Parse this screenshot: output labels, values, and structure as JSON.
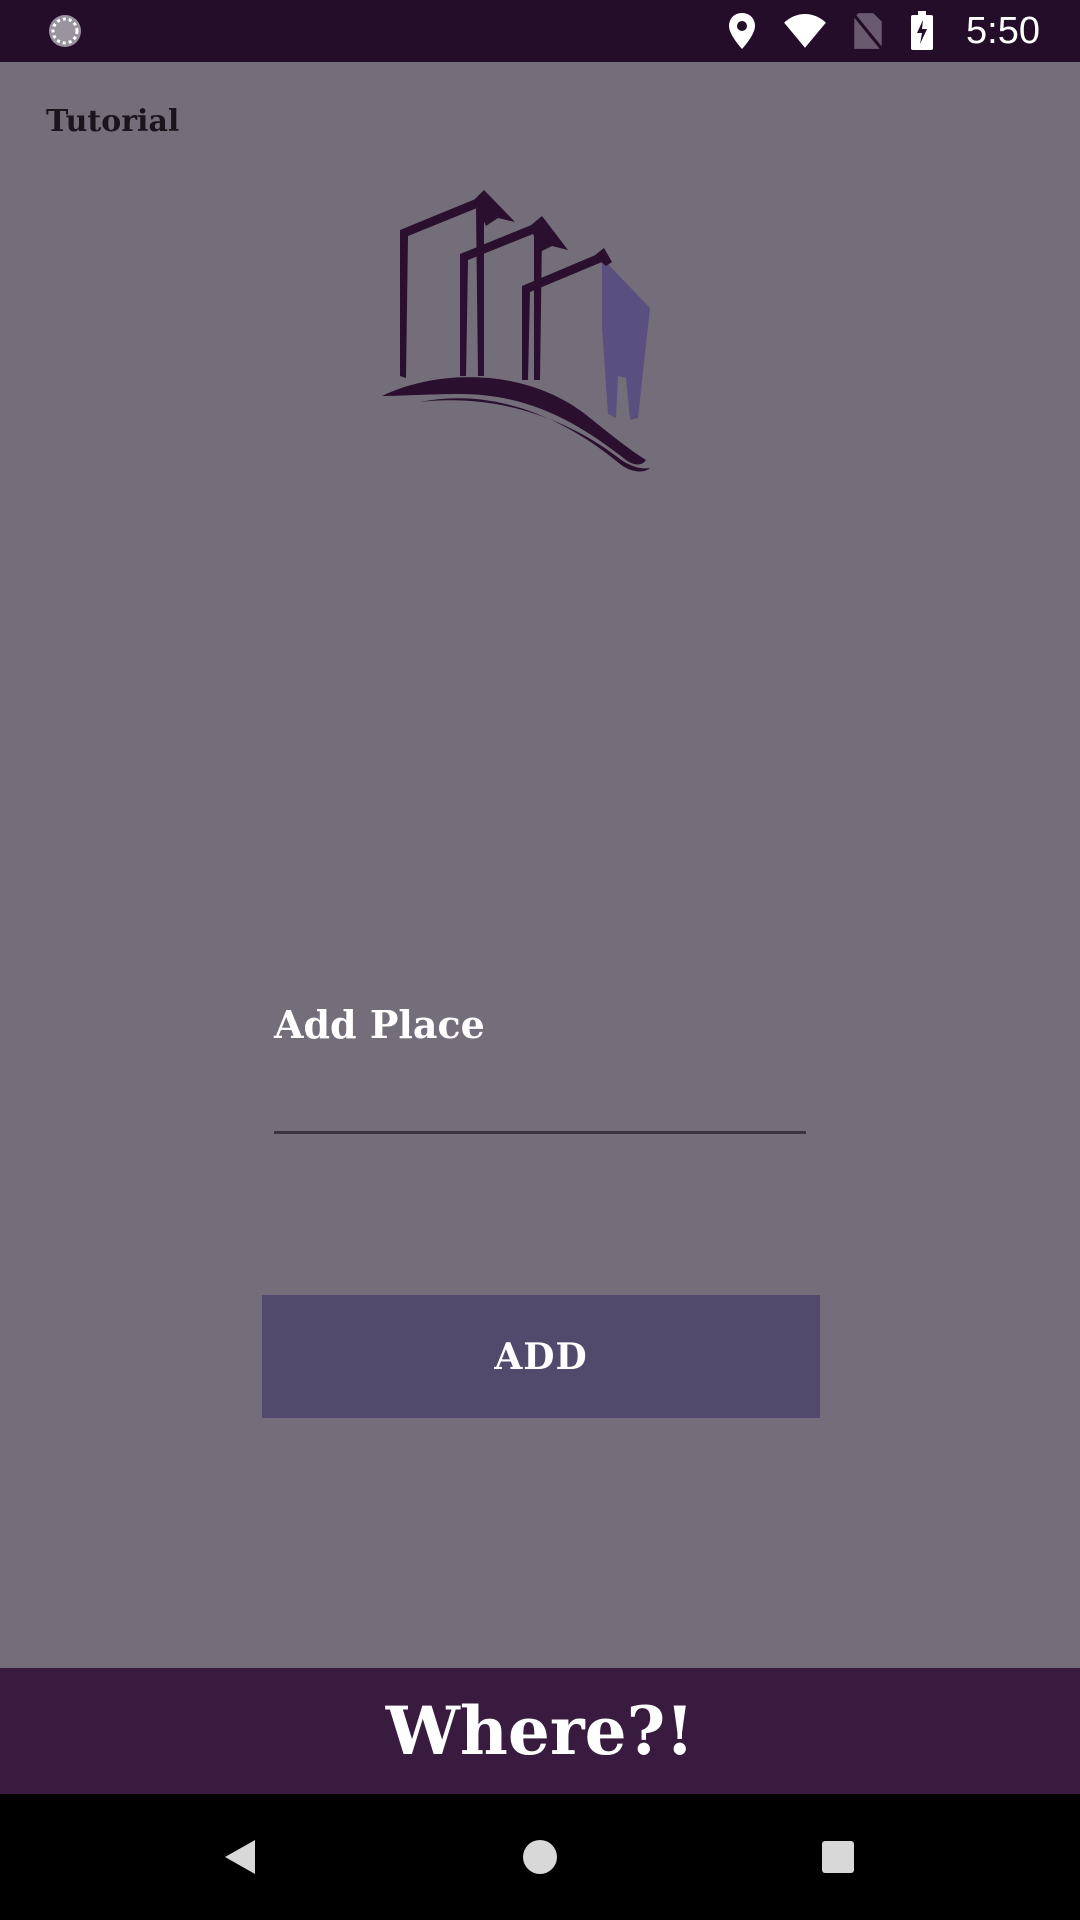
{
  "status_bar": {
    "time": "5:50",
    "icons": [
      "loading-icon",
      "location-pin-icon",
      "wifi-icon",
      "no-sim-icon",
      "battery-charging-icon"
    ]
  },
  "header": {
    "tutorial_label": "Tutorial"
  },
  "logo": {
    "icon": "city-buildings-logo-icon"
  },
  "form": {
    "field_label": "Add Place",
    "field_value": "",
    "add_button_label": "ADD"
  },
  "footer": {
    "brand_title": "Where?!"
  },
  "nav_bar": {
    "icons": [
      "back-icon",
      "home-icon",
      "recents-icon"
    ]
  },
  "colors": {
    "background": "#736e7a",
    "status_bar": "#230d28",
    "button": "#524a6d",
    "brand_bar": "#381b3e",
    "logo_dark": "#2a0f2e",
    "logo_accent": "#5a5080"
  }
}
